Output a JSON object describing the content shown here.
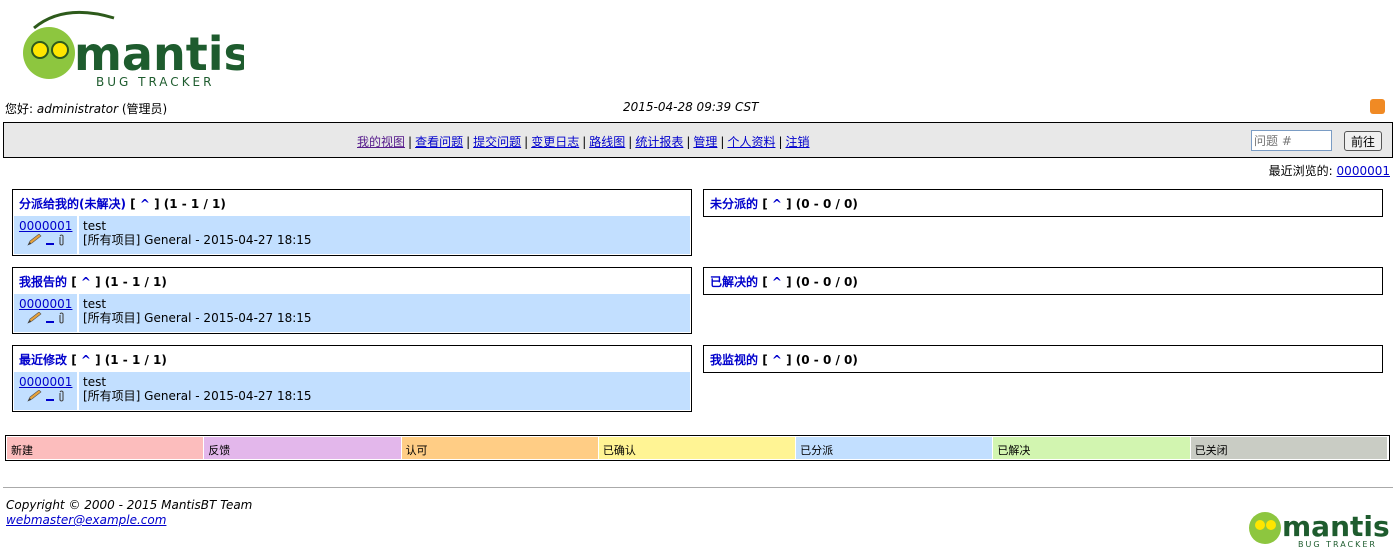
{
  "logo": {
    "name": "mantis",
    "tagline": "BUG TRACKER"
  },
  "header": {
    "greeting": "您好:",
    "username": "administrator",
    "role": "(管理员)",
    "datetime": "2015-04-28 09:39 CST"
  },
  "menu": {
    "items": [
      "我的视图",
      "查看问题",
      "提交问题",
      "变更日志",
      "路线图",
      "统计报表",
      "管理",
      "个人资料",
      "注销"
    ],
    "issue_placeholder": "问题 #",
    "go_label": "前往"
  },
  "recent": {
    "label": "最近浏览的:",
    "issue": "0000001"
  },
  "boxes": [
    {
      "title": "分派给我的(未解决)",
      "jump": "[ ^ ]",
      "range": "(1 - 1 / 1)",
      "issues": [
        {
          "id": "0000001",
          "summary": "test",
          "detail": "[所有项目] General - 2015-04-27 18:15"
        }
      ]
    },
    {
      "title": "未分派的",
      "jump": "[ ^ ]",
      "range": "(0 - 0 / 0)",
      "issues": []
    },
    {
      "title": "我报告的",
      "jump": "[ ^ ]",
      "range": "(1 - 1 / 1)",
      "issues": [
        {
          "id": "0000001",
          "summary": "test",
          "detail": "[所有项目] General - 2015-04-27 18:15"
        }
      ]
    },
    {
      "title": "已解决的",
      "jump": "[ ^ ]",
      "range": "(0 - 0 / 0)",
      "issues": []
    },
    {
      "title": "最近修改",
      "jump": "[ ^ ]",
      "range": "(1 - 1 / 1)",
      "issues": [
        {
          "id": "0000001",
          "summary": "test",
          "detail": "[所有项目] General - 2015-04-27 18:15"
        }
      ]
    },
    {
      "title": "我监视的",
      "jump": "[ ^ ]",
      "range": "(0 - 0 / 0)",
      "issues": []
    }
  ],
  "legend": [
    {
      "label": "新建",
      "color": "#fcbdbd"
    },
    {
      "label": "反馈",
      "color": "#e3b7eb"
    },
    {
      "label": "认可",
      "color": "#ffcd85"
    },
    {
      "label": "已确认",
      "color": "#fff494"
    },
    {
      "label": "已分派",
      "color": "#c2dfff"
    },
    {
      "label": "已解决",
      "color": "#d2f5b0"
    },
    {
      "label": "已关闭",
      "color": "#c9ccc4"
    }
  ],
  "footer": {
    "copyright": "Copyright © 2000 - 2015 MantisBT Team",
    "email": "webmaster@example.com"
  }
}
